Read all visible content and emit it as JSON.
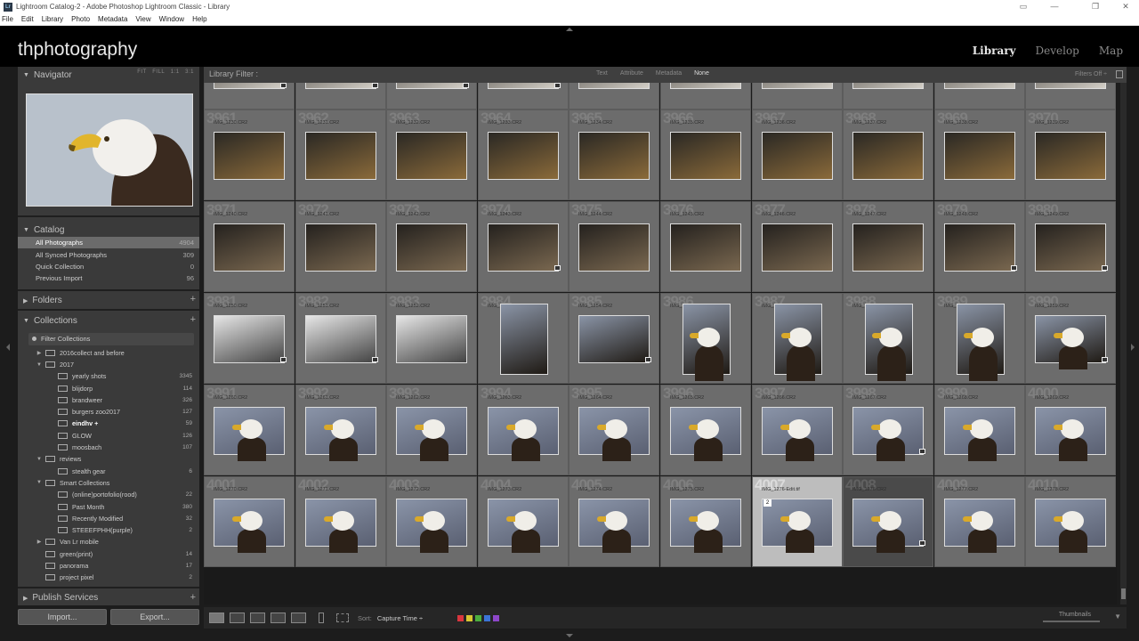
{
  "window": {
    "title": "Lightroom Catalog-2 - Adobe Photoshop Lightroom Classic - Library",
    "app_icon": "Lr",
    "controls": [
      "▭",
      "—",
      "❐",
      "✕"
    ]
  },
  "menu": [
    "File",
    "Edit",
    "Library",
    "Photo",
    "Metadata",
    "View",
    "Window",
    "Help"
  ],
  "identity_plate": "thphotography",
  "modules": [
    {
      "label": "Library",
      "active": true
    },
    {
      "label": "Develop",
      "active": false
    },
    {
      "label": "Map",
      "active": false
    }
  ],
  "navigator": {
    "title": "Navigator",
    "options": [
      "FIT",
      "FILL",
      "1:1",
      "3:1"
    ]
  },
  "catalog": {
    "title": "Catalog",
    "items": [
      {
        "label": "All Photographs",
        "count": "4904",
        "selected": true
      },
      {
        "label": "All Synced Photographs",
        "count": "309",
        "selected": false
      },
      {
        "label": "Quick Collection",
        "count": "0",
        "selected": false
      },
      {
        "label": "Previous Import",
        "count": "96",
        "selected": false
      }
    ]
  },
  "folders": {
    "title": "Folders"
  },
  "collections": {
    "title": "Collections",
    "filter_label": "Filter Collections",
    "items": [
      {
        "label": "2016collect and before",
        "count": "",
        "level": 1,
        "twisty": "▶",
        "bold": false
      },
      {
        "label": "2017",
        "count": "",
        "level": 1,
        "twisty": "▼",
        "bold": false
      },
      {
        "label": "yearly shots",
        "count": "3345",
        "level": 2,
        "twisty": "",
        "bold": false
      },
      {
        "label": "blijdorp",
        "count": "114",
        "level": 2,
        "twisty": "",
        "bold": false
      },
      {
        "label": "brandweer",
        "count": "326",
        "level": 2,
        "twisty": "",
        "bold": false
      },
      {
        "label": "burgers zoo2017",
        "count": "127",
        "level": 2,
        "twisty": "",
        "bold": false
      },
      {
        "label": "eindhv +",
        "count": "59",
        "level": 2,
        "twisty": "",
        "bold": true
      },
      {
        "label": "GLOW",
        "count": "126",
        "level": 2,
        "twisty": "",
        "bold": false
      },
      {
        "label": "moosbach",
        "count": "107",
        "level": 2,
        "twisty": "",
        "bold": false
      },
      {
        "label": "reviews",
        "count": "",
        "level": 1,
        "twisty": "▼",
        "bold": false
      },
      {
        "label": "stealth gear",
        "count": "6",
        "level": 2,
        "twisty": "",
        "bold": false
      },
      {
        "label": "Smart Collections",
        "count": "",
        "level": 1,
        "twisty": "▼",
        "bold": false
      },
      {
        "label": "(online)portofolio(rood)",
        "count": "22",
        "level": 2,
        "twisty": "",
        "bold": false
      },
      {
        "label": "Past Month",
        "count": "380",
        "level": 2,
        "twisty": "",
        "bold": false
      },
      {
        "label": "Recently Modified",
        "count": "32",
        "level": 2,
        "twisty": "",
        "bold": false
      },
      {
        "label": "STEEEFPHH(purple)",
        "count": "2",
        "level": 2,
        "twisty": "",
        "bold": false
      },
      {
        "label": "Van Lr mobile",
        "count": "",
        "level": 1,
        "twisty": "▶",
        "bold": false
      },
      {
        "label": "green(print)",
        "count": "14",
        "level": 1,
        "twisty": "",
        "bold": false
      },
      {
        "label": "panorama",
        "count": "17",
        "level": 1,
        "twisty": "",
        "bold": false
      },
      {
        "label": "project pixel",
        "count": "2",
        "level": 1,
        "twisty": "",
        "bold": false
      }
    ]
  },
  "publish_services": {
    "title": "Publish Services"
  },
  "import_button": "Import...",
  "export_button": "Export...",
  "library_filter": {
    "label": "Library Filter :",
    "options": [
      {
        "label": "Text",
        "active": false
      },
      {
        "label": "Attribute",
        "active": false
      },
      {
        "label": "Metadata",
        "active": false
      },
      {
        "label": "None",
        "active": true
      }
    ],
    "preset": "Filters Off ÷"
  },
  "grid": {
    "rows": [
      {
        "idx": [
          "",
          "",
          "",
          "",
          "",
          "",
          "",
          "",
          "",
          ""
        ],
        "files": [
          "",
          "",
          "",
          "",
          "",
          "",
          "",
          "",
          "",
          ""
        ]
      },
      {
        "idx": [
          "3961",
          "3962",
          "3963",
          "3964",
          "3965",
          "3966",
          "3967",
          "3968",
          "3969",
          "3970"
        ],
        "files": [
          "IMG_1230.CR2",
          "IMG_1231.CR2",
          "IMG_1232.CR2",
          "IMG_1233.CR2",
          "IMG_1234.CR2",
          "IMG_1235.CR2",
          "IMG_1236.CR2",
          "IMG_1237.CR2",
          "IMG_1238.CR2",
          "IMG_1239.CR2"
        ]
      },
      {
        "idx": [
          "3971",
          "3972",
          "3973",
          "3974",
          "3975",
          "3976",
          "3977",
          "3978",
          "3979",
          "3980"
        ],
        "files": [
          "IMG_1240.CR2",
          "IMG_1241.CR2",
          "IMG_1242.CR2",
          "IMG_1243.CR2",
          "IMG_1244.CR2",
          "IMG_1245.CR2",
          "IMG_1246.CR2",
          "IMG_1247.CR2",
          "IMG_1248.CR2",
          "IMG_1249.CR2"
        ]
      },
      {
        "idx": [
          "3981",
          "3982",
          "3983",
          "3984",
          "3985",
          "3986",
          "3987",
          "3988",
          "3989",
          "3990"
        ],
        "files": [
          "IMG_1250.CR2",
          "IMG_1251.CR2",
          "IMG_1252.CR2",
          "IMG_1253.CR2",
          "IMG_1254.CR2",
          "IMG_1255.CR2",
          "IMG_1256.CR2",
          "IMG_1257.CR2",
          "IMG_1258.CR2",
          "IMG_1259.CR2"
        ]
      },
      {
        "idx": [
          "3991",
          "3992",
          "3993",
          "3994",
          "3995",
          "3996",
          "3997",
          "3998",
          "3999",
          "4000"
        ],
        "files": [
          "IMG_1260.CR2",
          "IMG_1261.CR2",
          "IMG_1262.CR2",
          "IMG_1263.CR2",
          "IMG_1264.CR2",
          "IMG_1265.CR2",
          "IMG_1266.CR2",
          "IMG_1267.CR2",
          "IMG_1268.CR2",
          "IMG_1269.CR2"
        ]
      },
      {
        "idx": [
          "4001",
          "4002",
          "4003",
          "4004",
          "4005",
          "4006",
          "4007",
          "4008",
          "4009",
          "4010"
        ],
        "files": [
          "IMG_1270.CR2",
          "IMG_1271.CR2",
          "IMG_1272.CR2",
          "IMG_1273.CR2",
          "IMG_1274.CR2",
          "IMG_1275.CR2",
          "IMG_1276-Edit.tif",
          "IMG_1276.CR2",
          "IMG_1277.CR2",
          "IMG_1278.CR2"
        ]
      }
    ],
    "stack_count": "2"
  },
  "toolbar": {
    "sort_label": "Sort:",
    "sort_value": "Capture Time ÷",
    "thumbnails_label": "Thumbnails",
    "color_labels": [
      "#d9363e",
      "#d8c632",
      "#4cae3e",
      "#3c74d6",
      "#8d47c9"
    ]
  }
}
